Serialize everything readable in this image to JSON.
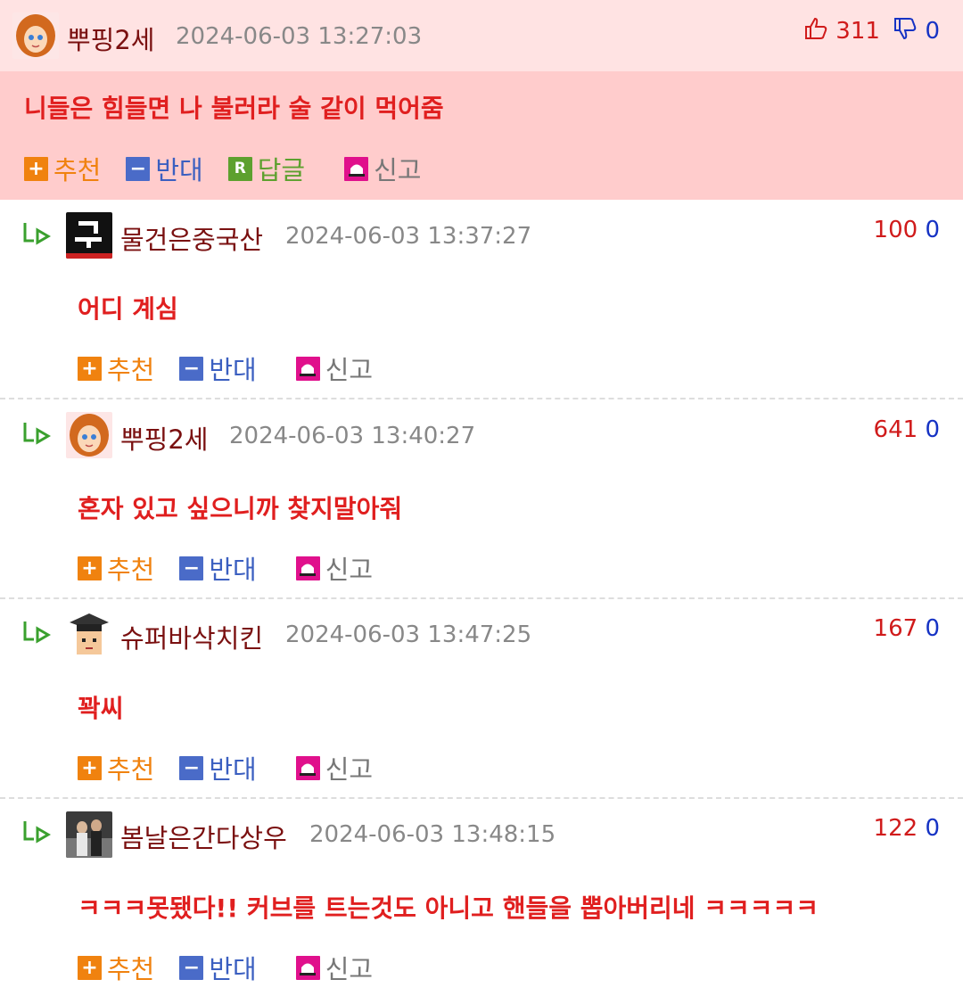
{
  "top_comment": {
    "nickname": "뿌핑2세",
    "date": "2024-06-03 13:27:03",
    "upvotes": "311",
    "downvotes": "0",
    "text": "니들은 힘들면 나 불러라 술 같이 먹어줌",
    "actions": {
      "recommend": "추천",
      "oppose": "반대",
      "reply": "답글",
      "report": "신고"
    }
  },
  "replies": [
    {
      "nickname": "물건은중국산",
      "date": "2024-06-03 13:37:27",
      "upvotes": "100",
      "downvotes": "0",
      "text": "어디 계심"
    },
    {
      "nickname": "뿌핑2세",
      "date": "2024-06-03 13:40:27",
      "upvotes": "641",
      "downvotes": "0",
      "text": "혼자 있고 싶으니까 찾지말아줘"
    },
    {
      "nickname": "슈퍼바삭치킨",
      "date": "2024-06-03 13:47:25",
      "upvotes": "167",
      "downvotes": "0",
      "text": "꽉씨"
    },
    {
      "nickname": "봄날은간다상우",
      "date": "2024-06-03 13:48:15",
      "upvotes": "122",
      "downvotes": "0",
      "text": "ㅋㅋㅋ못됐다!! 커브를 트는것도 아니고 핸들을 뽑아버리네 ㅋㅋㅋㅋㅋ"
    }
  ],
  "reply_actions": {
    "recommend": "추천",
    "oppose": "반대",
    "report": "신고"
  },
  "colors": {
    "top_bg": "#ffcccc",
    "top_header_bg": "#ffe3e3",
    "text_red": "#e01f1f",
    "nick": "#7a1010",
    "up": "#d01b1b",
    "down": "#1633c4"
  }
}
